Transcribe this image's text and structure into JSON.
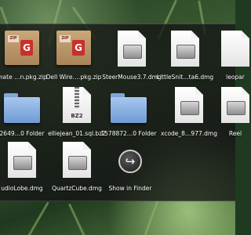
{
  "stack": {
    "rows": [
      [
        {
          "label": "mate …n.pkg.zip",
          "icon": "package-zip-icon"
        },
        {
          "label": "Dell Wire….pkg.zip",
          "icon": "package-zip-icon"
        },
        {
          "label": "SteerMouse3.7.dmg",
          "icon": "disk-image-icon"
        },
        {
          "label": "LittleSnit…ta6.dmg",
          "icon": "disk-image-icon"
        },
        {
          "label": "leopar",
          "icon": "document-icon"
        }
      ],
      [
        {
          "label": "2649…0 Folder",
          "icon": "folder-icon"
        },
        {
          "label": "elliejean_01.sql.bz2",
          "icon": "bz2-archive-icon",
          "badge": "BZ2"
        },
        {
          "label": "1578872…0 Folder",
          "icon": "folder-icon"
        },
        {
          "label": "xcode_8…977.dmg",
          "icon": "disk-image-icon"
        },
        {
          "label": "Reel",
          "icon": "disk-image-icon"
        }
      ],
      [
        {
          "label": "udioLobe.dmg",
          "icon": "disk-image-icon"
        },
        {
          "label": "QuartzCube.dmg",
          "icon": "disk-image-icon"
        },
        {
          "label": "Show in Finder",
          "icon": "show-in-finder-icon",
          "glyph": "↪"
        }
      ]
    ],
    "zip_tag": "ZIP",
    "pkg_glyph": "G"
  }
}
